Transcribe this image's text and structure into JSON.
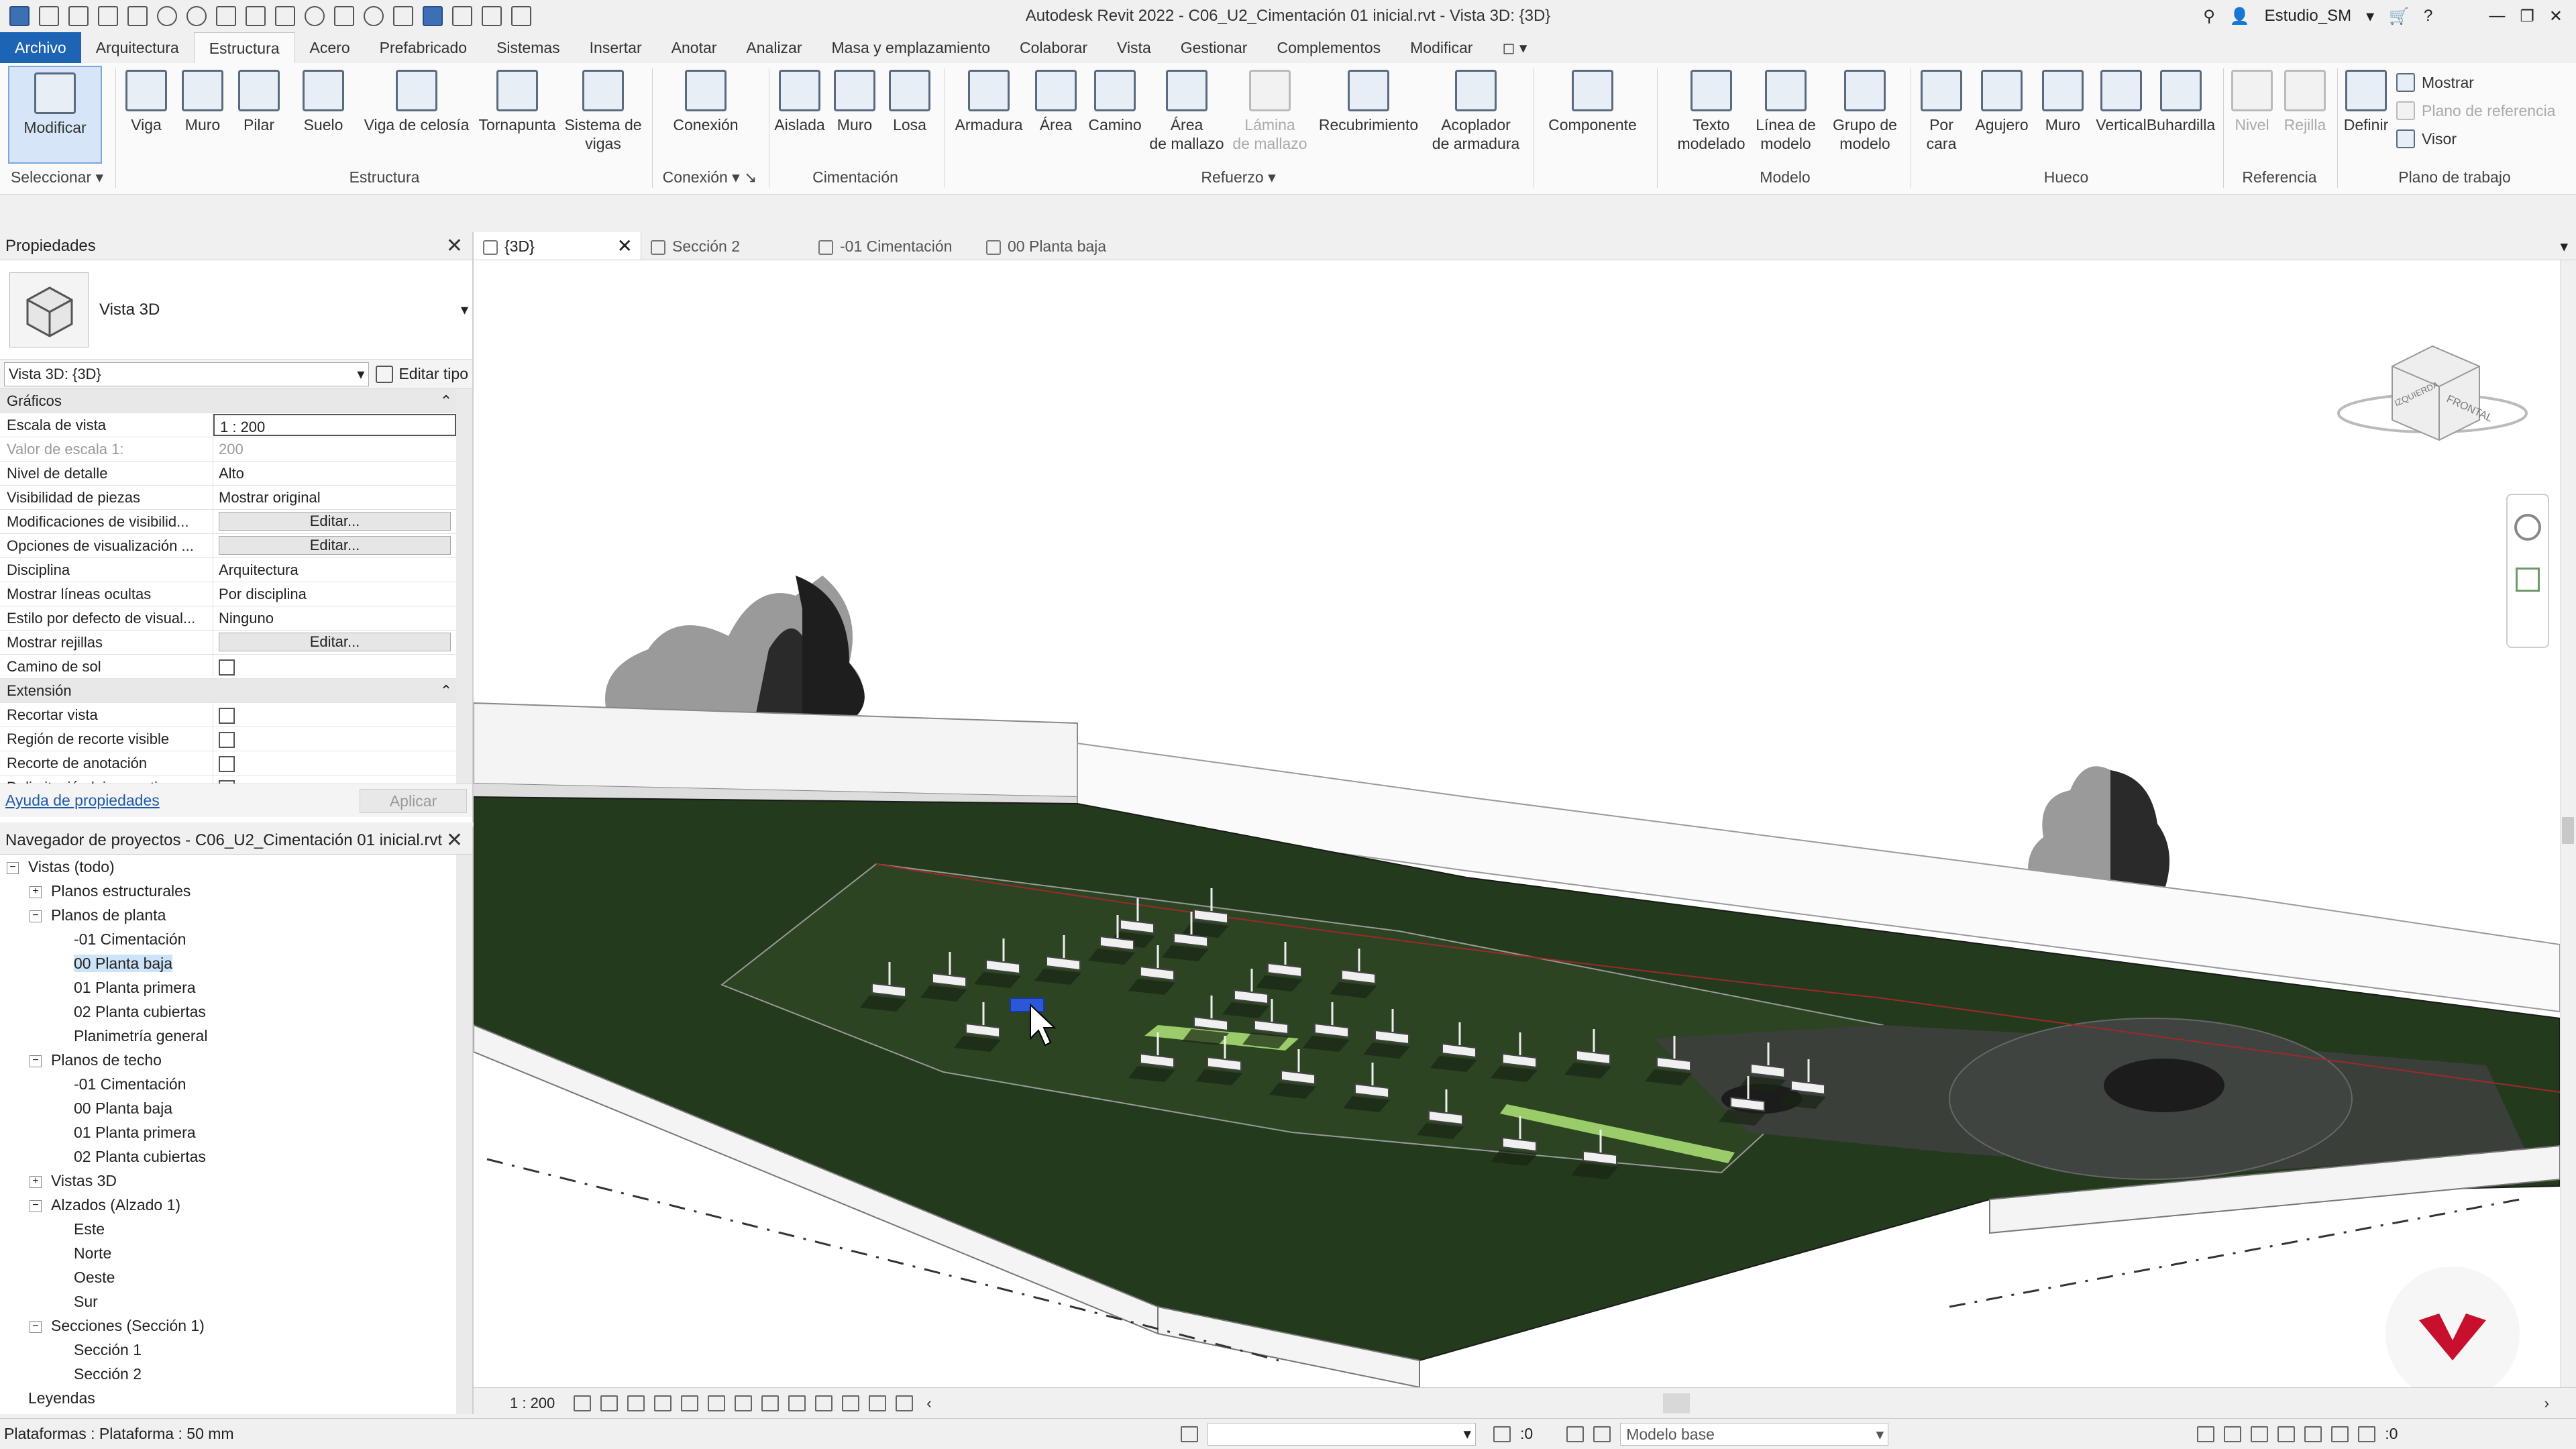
{
  "window": {
    "title": "Autodesk Revit 2022 - C06_U2_Cimentación 01 inicial.rvt - Vista 3D: {3D}",
    "user": "Estudio_SM"
  },
  "ribbon_tabs": [
    "Archivo",
    "Arquitectura",
    "Estructura",
    "Acero",
    "Prefabricado",
    "Sistemas",
    "Insertar",
    "Anotar",
    "Analizar",
    "Masa y emplazamiento",
    "Colaborar",
    "Vista",
    "Gestionar",
    "Complementos",
    "Modificar"
  ],
  "ribbon": {
    "select_group": "Seleccionar",
    "modify": "Modificar",
    "structure_group": "Estructura",
    "structure": [
      "Viga",
      "Muro",
      "Pilar",
      "Suelo",
      "Viga de celosía",
      "Tornapunta"
    ],
    "beam_system": [
      "Sistema de",
      "vigas"
    ],
    "connection_group": "Conexión",
    "connection": "Conexión",
    "foundation_group": "Cimentación",
    "foundation": [
      "Aislada",
      "Muro",
      "Losa"
    ],
    "rebar_group": "Refuerzo",
    "rebar": [
      "Armadura",
      "Área",
      "Camino"
    ],
    "mesh_area": [
      "Área",
      "de mallazo"
    ],
    "mesh_sheet": [
      "Lámina",
      "de mallazo"
    ],
    "cover": "Recubrimiento",
    "coupler": [
      "Acoplador",
      "de armadura"
    ],
    "component": "Componente",
    "model_group": "Modelo",
    "model_text": [
      "Texto",
      "modelado"
    ],
    "model_line": [
      "Línea de",
      "modelo"
    ],
    "model_group_btn": [
      "Grupo de",
      "modelo"
    ],
    "opening_group": "Hueco",
    "by_face": [
      "Por",
      "cara"
    ],
    "opening": [
      "Agujero",
      "Muro",
      "Vertical",
      "Buhardilla"
    ],
    "reference_group": "Referencia",
    "reference": [
      "Nivel",
      "Rejilla"
    ],
    "workplane_group": "Plano de trabajo",
    "define": "Definir",
    "workplane_small": [
      "Mostrar",
      "Plano de referencia",
      "Visor"
    ]
  },
  "properties": {
    "title": "Propiedades",
    "type_name": "Vista 3D",
    "instance_selector": "Vista 3D: {3D}",
    "edit_type": "Editar tipo",
    "sections": [
      {
        "name": "Gráficos",
        "rows": [
          {
            "k": "Escala de vista",
            "v": "1 : 200",
            "kind": "boxed"
          },
          {
            "k": "Valor de escala    1:",
            "v": "200",
            "kind": "dim"
          },
          {
            "k": "Nivel de detalle",
            "v": "Alto"
          },
          {
            "k": "Visibilidad de piezas",
            "v": "Mostrar original"
          },
          {
            "k": "Modificaciones de visibilid...",
            "v": "Editar...",
            "kind": "btn"
          },
          {
            "k": "Opciones de visualización ...",
            "v": "Editar...",
            "kind": "btn"
          },
          {
            "k": "Disciplina",
            "v": "Arquitectura"
          },
          {
            "k": "Mostrar líneas ocultas",
            "v": "Por disciplina"
          },
          {
            "k": "Estilo por defecto de visual...",
            "v": "Ninguno"
          },
          {
            "k": "Mostrar rejillas",
            "v": "Editar...",
            "kind": "btn"
          },
          {
            "k": "Camino de sol",
            "v": "",
            "kind": "check"
          }
        ]
      },
      {
        "name": "Extensión",
        "rows": [
          {
            "k": "Recortar vista",
            "v": "",
            "kind": "check"
          },
          {
            "k": "Región de recorte visible",
            "v": "",
            "kind": "check"
          },
          {
            "k": "Recorte de anotación",
            "v": "",
            "kind": "check"
          },
          {
            "k": "Delimitación lejana activa",
            "v": "",
            "kind": "check"
          }
        ]
      }
    ],
    "help_link": "Ayuda de propiedades",
    "apply": "Aplicar"
  },
  "browser": {
    "title": "Navegador de proyectos - C06_U2_Cimentación 01 inicial.rvt",
    "items": [
      {
        "label": "Vistas (todo)",
        "level": 0,
        "toggle": "−"
      },
      {
        "label": "Planos estructurales",
        "level": 1,
        "toggle": "+"
      },
      {
        "label": "Planos de planta",
        "level": 1,
        "toggle": "−"
      },
      {
        "label": "-01 Cimentación",
        "level": 2
      },
      {
        "label": "00 Planta baja",
        "level": 2,
        "highlight": true
      },
      {
        "label": "01 Planta primera",
        "level": 2
      },
      {
        "label": "02 Planta cubiertas",
        "level": 2
      },
      {
        "label": "Planimetría general",
        "level": 2
      },
      {
        "label": "Planos de techo",
        "level": 1,
        "toggle": "−"
      },
      {
        "label": "-01 Cimentación",
        "level": 2
      },
      {
        "label": "00 Planta baja",
        "level": 2
      },
      {
        "label": "01 Planta primera",
        "level": 2
      },
      {
        "label": "02 Planta cubiertas",
        "level": 2
      },
      {
        "label": "Vistas 3D",
        "level": 1,
        "toggle": "+"
      },
      {
        "label": "Alzados (Alzado 1)",
        "level": 1,
        "toggle": "−"
      },
      {
        "label": "Este",
        "level": 2
      },
      {
        "label": "Norte",
        "level": 2
      },
      {
        "label": "Oeste",
        "level": 2
      },
      {
        "label": "Sur",
        "level": 2
      },
      {
        "label": "Secciones (Sección 1)",
        "level": 1,
        "toggle": "−"
      },
      {
        "label": "Sección 1",
        "level": 2
      },
      {
        "label": "Sección 2",
        "level": 2
      },
      {
        "label": "Leyendas",
        "level": 0
      }
    ]
  },
  "view_tabs": [
    {
      "label": "{3D}",
      "active": true
    },
    {
      "label": "Sección 2"
    },
    {
      "label": "-01 Cimentación"
    },
    {
      "label": "00 Planta baja"
    }
  ],
  "viewcube": {
    "face_label": "FRONTAL",
    "side_label": "IZQUIERDA"
  },
  "view_bar": {
    "scale": "1 : 200"
  },
  "status": {
    "text": "Plataformas : Plataforma : 50 mm",
    "selection_count": ":0",
    "model": "Modelo base",
    "filter_count": ":0"
  },
  "colors": {
    "file_tab": "#1e64b4",
    "terrain": "#243a1c",
    "logo": "#c8102e"
  }
}
